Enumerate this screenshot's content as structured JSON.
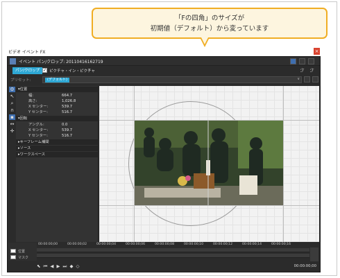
{
  "callout": {
    "line1": "「Fの四角」のサイズが",
    "line2": "初期値（デフォルト）から変っています"
  },
  "window": {
    "title": "ビデオ イベント FX",
    "close_label": "×",
    "header_title": "イベント パン/クロップ: 20110416162719"
  },
  "tabs": {
    "pan_crop": "パン/クロップ",
    "pip_checked": "✓",
    "pip": "ピクチャ・イン・ピクチャ",
    "pip_arrow": "∨"
  },
  "preset": {
    "label": "プリセット:",
    "value": "(デフォルト)",
    "arrow": "∨"
  },
  "properties": {
    "position_section": "▾位置",
    "width_label": "幅:",
    "width_value": "664.7",
    "height_label": "高さ:",
    "height_value": "1,026.8",
    "xcenter_label": "X センター:",
    "xcenter_value": "539.7",
    "ycenter_label": "Y センター:",
    "ycenter_value": "516.7",
    "rotation_section": "▾回転",
    "angle_label": "アングル:",
    "angle_value": "0.0",
    "rot_xcenter_label": "X センター:",
    "rot_xcenter_value": "539.7",
    "rot_ycenter_label": "Y センター:",
    "rot_ycenter_value": "516.7",
    "keyframe_section": "▸キーフレーム補間",
    "source_section": "▸ソース",
    "workspace_section": "▸ワークスペース"
  },
  "timeline": {
    "label_pos": "位置",
    "label_mask": "マスク",
    "ticks": [
      "00:00:00;00",
      "00:00:00;02",
      "00:00:00;04",
      "00:00:00;06",
      "00:00:00;08",
      "00:00:00;10",
      "00:00:00;12",
      "00:00:00;14",
      "00:00:00;16"
    ],
    "controls": "⬉ ⏮ ◀ ▶ ⏭ ◆ ◇",
    "current_time": "00:00:00;00"
  }
}
